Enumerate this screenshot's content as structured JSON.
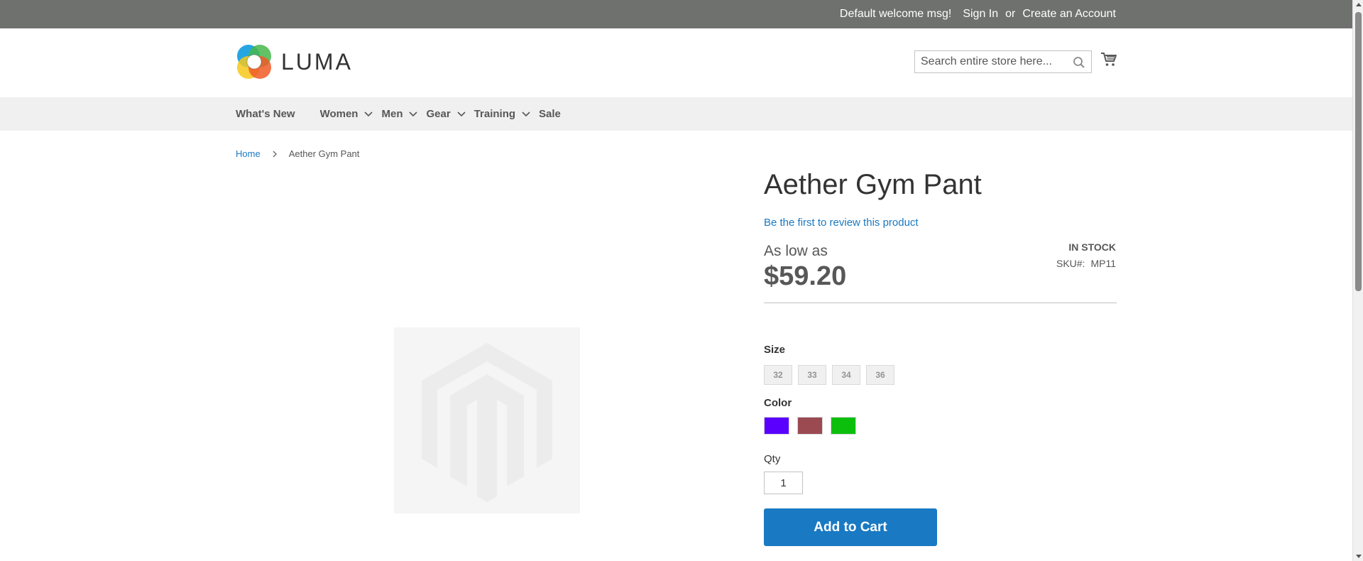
{
  "topbar": {
    "welcome": "Default welcome msg!",
    "sign_in": "Sign In",
    "or": "or",
    "create_account": "Create an Account"
  },
  "header": {
    "logo_text": "LUMA",
    "search_placeholder": "Search entire store here...",
    "search_value": ""
  },
  "nav": {
    "items": [
      {
        "label": "What's New",
        "has_dropdown": false
      },
      {
        "label": "Women",
        "has_dropdown": true
      },
      {
        "label": "Men",
        "has_dropdown": true
      },
      {
        "label": "Gear",
        "has_dropdown": true
      },
      {
        "label": "Training",
        "has_dropdown": true
      },
      {
        "label": "Sale",
        "has_dropdown": false
      }
    ]
  },
  "breadcrumb": {
    "home": "Home",
    "current": "Aether Gym Pant"
  },
  "product": {
    "title": "Aether Gym Pant",
    "review_link": "Be the first to review this product",
    "price_prefix": "As low as",
    "price": "$59.20",
    "stock": "In stock",
    "sku_label": "SKU#:",
    "sku": "MP11",
    "size_label": "Size",
    "sizes": [
      "32",
      "33",
      "34",
      "36"
    ],
    "color_label": "Color",
    "colors": [
      "#5a00ff",
      "#9b4a52",
      "#0dbf0d"
    ],
    "qty_label": "Qty",
    "qty_value": "1",
    "add_to_cart": "Add to Cart"
  },
  "colors": {
    "topbar_bg": "#6e716e",
    "nav_bg": "#f0f0f0",
    "link": "#1979c3",
    "primary_button": "#1979c3"
  }
}
